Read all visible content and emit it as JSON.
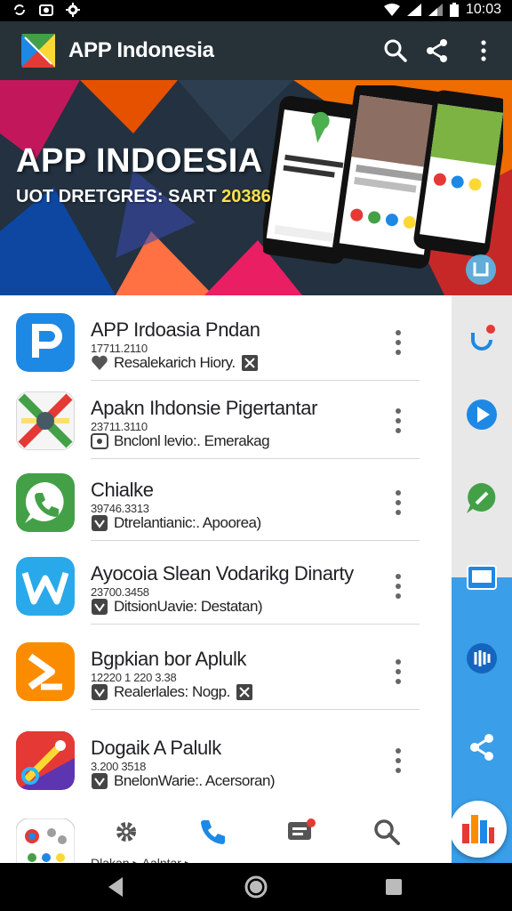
{
  "status_bar": {
    "time": "10:03"
  },
  "app_bar": {
    "title": "APP Indonesia"
  },
  "banner": {
    "headline": "APP INDOESIA",
    "subtitle_main": "UOT DRETGRES: SART",
    "subtitle_highlight": "20386"
  },
  "apps": [
    {
      "title": "APP Irdoasia Pndan",
      "sub": "17711.2110",
      "meta": "Resalekarich Hiory."
    },
    {
      "title": "Apakn Ihdonsie Pigertantar",
      "sub": "23711.3110",
      "meta": "Bnclonl levio:. Emerakag"
    },
    {
      "title": "Chialke",
      "sub": "39746.3313",
      "meta": "Dtrelantianic:. Apoorea)"
    },
    {
      "title": "Ayocoia Slean Vodarikg Dinarty",
      "sub": "23700.3458",
      "meta": "DitsionUavie:  Destatan)"
    },
    {
      "title": "Bgpkian bor Aplulk",
      "sub": "12220 1 220 3.38",
      "meta": "Realerlales:  Nogp."
    },
    {
      "title": "Dogaik A Palulk",
      "sub": "3.200 3518",
      "meta": "BnelonWarie:. Acersoran)"
    }
  ],
  "bottom": {
    "label": "Dlakan ▸ Aalntar ▸"
  },
  "colors": {
    "appbar": "#263238",
    "side": "#3a9ee8",
    "accent": "#1e88e5"
  }
}
